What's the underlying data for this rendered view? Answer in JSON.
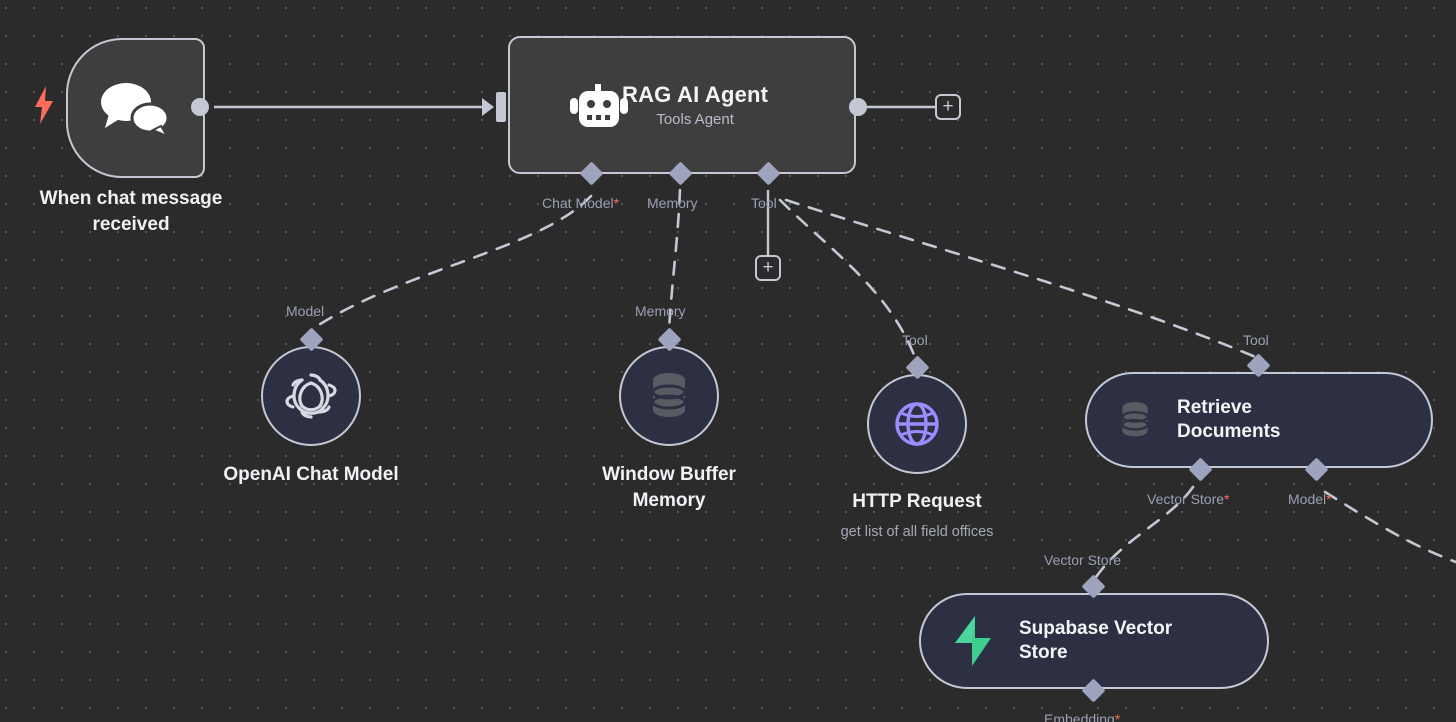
{
  "app": {
    "name": "n8n-workflow-canvas"
  },
  "canvas": {
    "background_color": "#2b2b2b",
    "grid_dot_color": "#555555",
    "accent_required": "#ff6d5a",
    "node_border": "#c4c8d4",
    "node_fill_dark": "#3e3e3e",
    "node_fill_navy": "#2d3043",
    "connector_color": "#c4c8d4"
  },
  "nodes": {
    "trigger": {
      "caption_line1": "When chat message",
      "caption_line2": "received",
      "icon": "chat-bubbles-icon",
      "trigger_icon": "lightning-bolt-icon"
    },
    "agent": {
      "title": "RAG AI Agent",
      "subtitle": "Tools Agent",
      "icon": "robot-icon",
      "ports": [
        {
          "label": "Chat Model",
          "required": true
        },
        {
          "label": "Memory",
          "required": false
        },
        {
          "label": "Tool",
          "required": false
        }
      ],
      "add_output_label": "+",
      "add_tool_label": "+"
    },
    "openai_chat_model": {
      "caption": "OpenAI Chat Model",
      "port_label": "Model",
      "icon": "openai-icon"
    },
    "window_buffer_memory": {
      "caption_line1": "Window Buffer",
      "caption_line2": "Memory",
      "port_label": "Memory",
      "icon": "database-icon"
    },
    "http_request": {
      "caption": "HTTP Request",
      "subcaption": "get list of all field offices",
      "port_label": "Tool",
      "icon": "globe-icon"
    },
    "retrieve_documents": {
      "title_line1": "Retrieve",
      "title_line2": "Documents",
      "port_label_top": "Tool",
      "port_label_left": "Vector Store",
      "port_label_left_required": true,
      "port_label_right": "Model",
      "port_label_right_required": true,
      "icon": "database-icon"
    },
    "supabase_vector_store": {
      "title_line1": "Supabase Vector",
      "title_line2": "Store",
      "port_label_top": "Vector Store",
      "port_label_bottom": "Embedding",
      "port_label_bottom_required": true,
      "icon": "supabase-icon",
      "icon_color": "#3ecf8e"
    }
  }
}
